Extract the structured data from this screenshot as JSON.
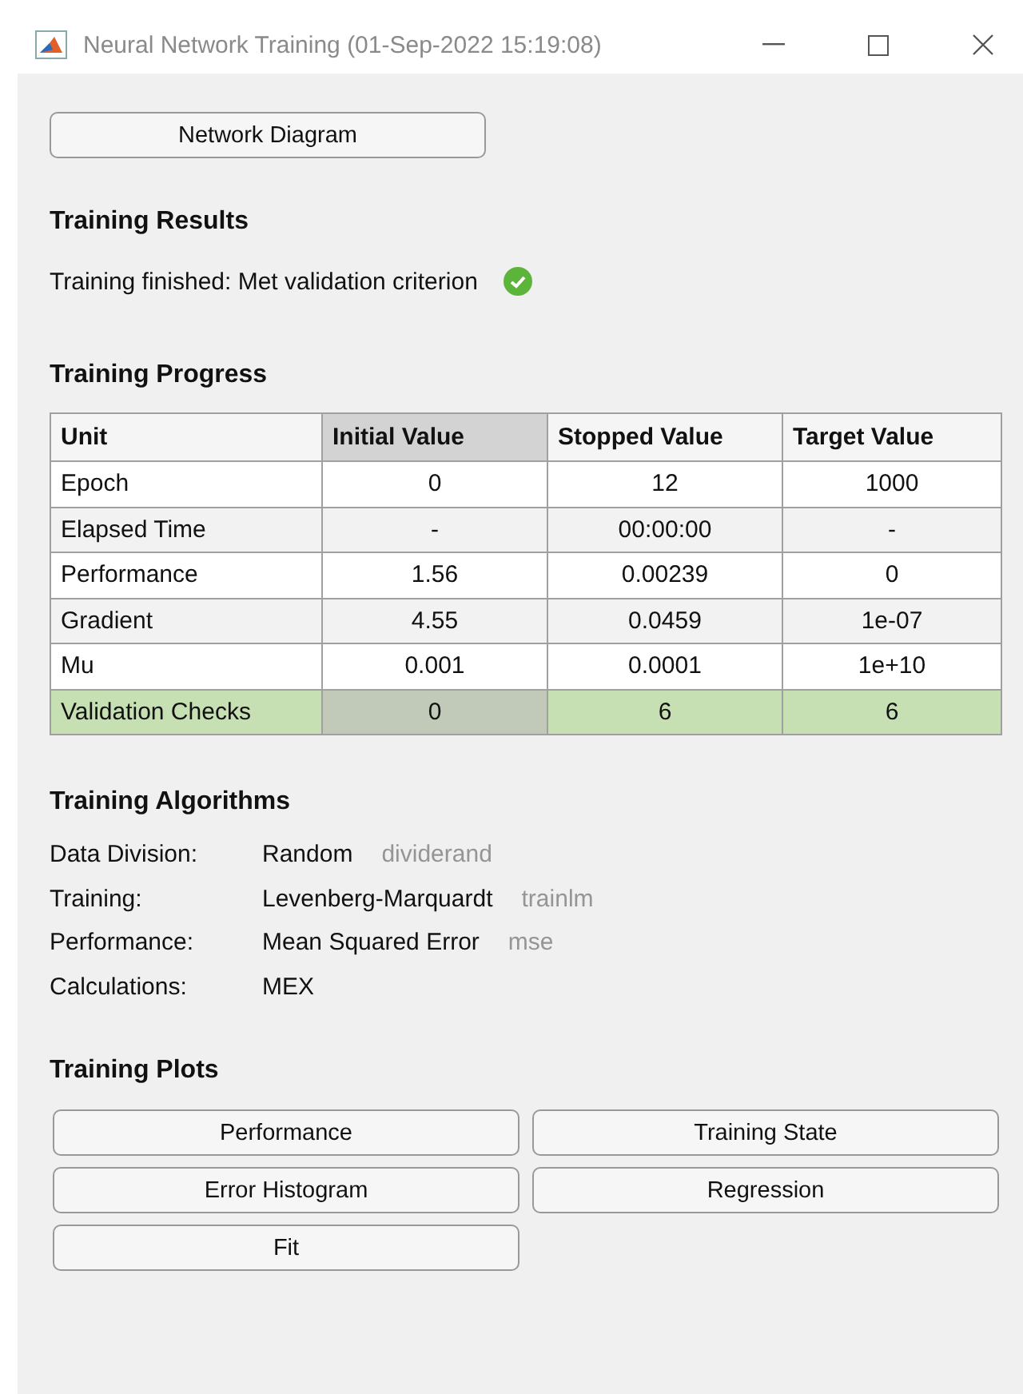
{
  "window": {
    "title": "Neural Network Training (01-Sep-2022 15:19:08)"
  },
  "network_diagram_button": "Network Diagram",
  "training_results": {
    "heading": "Training Results",
    "status": "Training finished: Met validation criterion",
    "status_ok": true
  },
  "training_progress": {
    "heading": "Training Progress",
    "columns": [
      {
        "label": "Unit",
        "selected": false
      },
      {
        "label": "Initial Value",
        "selected": true
      },
      {
        "label": "Stopped Value",
        "selected": false
      },
      {
        "label": "Target Value",
        "selected": false
      }
    ],
    "rows": [
      {
        "cells": [
          "Epoch",
          "0",
          "12",
          "1000"
        ],
        "highlighted": false
      },
      {
        "cells": [
          "Elapsed Time",
          "-",
          "00:00:00",
          "-"
        ],
        "highlighted": false
      },
      {
        "cells": [
          "Performance",
          "1.56",
          "0.00239",
          "0"
        ],
        "highlighted": false
      },
      {
        "cells": [
          "Gradient",
          "4.55",
          "0.0459",
          "1e-07"
        ],
        "highlighted": false
      },
      {
        "cells": [
          "Mu",
          "0.001",
          "0.0001",
          "1e+10"
        ],
        "highlighted": false
      },
      {
        "cells": [
          "Validation Checks",
          "0",
          "6",
          "6"
        ],
        "highlighted": true
      }
    ]
  },
  "training_algorithms": {
    "heading": "Training Algorithms",
    "items": [
      {
        "label": "Data Division:",
        "value": "Random",
        "function": "dividerand"
      },
      {
        "label": "Training:",
        "value": "Levenberg-Marquardt",
        "function": "trainlm"
      },
      {
        "label": "Performance:",
        "value": "Mean Squared Error",
        "function": "mse"
      },
      {
        "label": "Calculations:",
        "value": "MEX"
      }
    ]
  },
  "training_plots": {
    "heading": "Training Plots",
    "buttons": [
      "Performance",
      "Training State",
      "Error Histogram",
      "Regression",
      "Fit"
    ]
  }
}
